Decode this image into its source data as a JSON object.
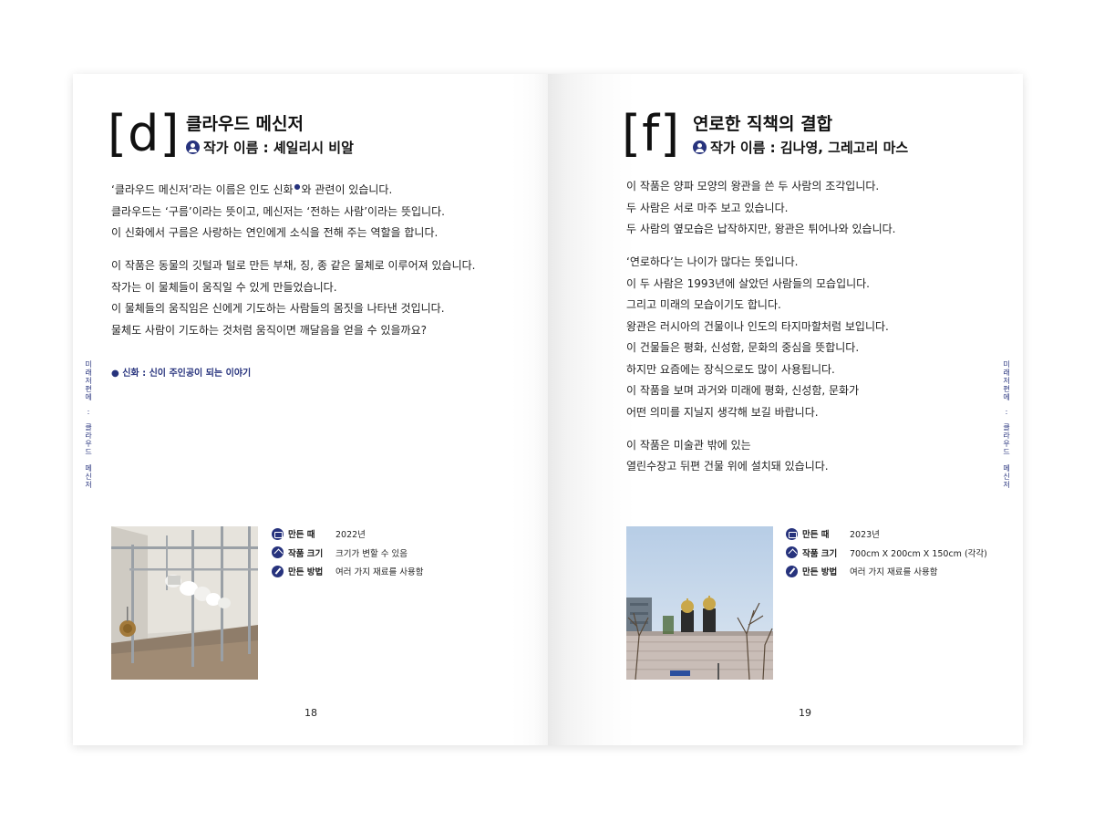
{
  "left_page": {
    "letter": "[d]",
    "title": "클라우드 메신저",
    "artist": "작가 이름 : 셰일리시 비알",
    "paragraphs": [
      {
        "lines": [
          {
            "before": "‘클라우드 메신저’라는 이름은 인도 신화",
            "sup": "●",
            "after": "와 관련이 있습니다."
          },
          {
            "text": "클라우드는 ‘구름’이라는 뜻이고, 메신저는 ‘전하는 사람’이라는 뜻입니다."
          },
          {
            "text": "이 신화에서 구름은 사랑하는 연인에게 소식을 전해 주는 역할을 합니다."
          }
        ]
      },
      {
        "lines": [
          {
            "text": "이 작품은 동물의 깃털과 털로 만든 부채, 징, 종 같은 물체로 이루어져 있습니다."
          },
          {
            "text": "작가는 이 물체들이 움직일 수 있게 만들었습니다."
          },
          {
            "text": "이 물체들의 움직임은 신에게 기도하는 사람들의 몸짓을 나타낸 것입니다."
          },
          {
            "text": "물체도 사람이 기도하는 것처럼 움직이면 깨달음을 얻을 수 있을까요?"
          }
        ]
      }
    ],
    "footnote": "● 신화 : 신이 주인공이 되는 이야기",
    "side_label": "미래저편에 : 클라우드 메신저",
    "meta": [
      {
        "icon": "calendar-icon",
        "label": "만든 때",
        "value": "2022년"
      },
      {
        "icon": "size-icon",
        "label": "작품 크기",
        "value": "크기가 변할 수 있음"
      },
      {
        "icon": "pen-icon",
        "label": "만든 방법",
        "value": "여러 가지 재료를 사용함"
      }
    ],
    "page_number": "18"
  },
  "right_page": {
    "letter": "[f]",
    "title": "연로한 직책의 결합",
    "artist": "작가 이름 : 김나영, 그레고리 마스",
    "paragraphs": [
      {
        "lines": [
          {
            "text": "이 작품은 양파 모양의 왕관을 쓴 두 사람의 조각입니다."
          },
          {
            "text": "두 사람은 서로 마주 보고 있습니다."
          },
          {
            "text": "두 사람의 옆모습은 납작하지만, 왕관은 튀어나와 있습니다."
          }
        ]
      },
      {
        "lines": [
          {
            "text": "‘연로하다’는 나이가 많다는 뜻입니다."
          },
          {
            "text": "이 두 사람은 1993년에 살았던 사람들의 모습입니다."
          },
          {
            "text": "그리고 미래의 모습이기도 합니다."
          },
          {
            "text": "왕관은 러시아의 건물이나 인도의 타지마할처럼 보입니다."
          },
          {
            "text": "이 건물들은 평화, 신성함, 문화의 중심을 뜻합니다."
          },
          {
            "text": "하지만 요즘에는 장식으로도 많이 사용됩니다."
          },
          {
            "text": "이 작품을 보며 과거와 미래에 평화, 신성함, 문화가"
          },
          {
            "text": "어떤 의미를 지닐지 생각해 보길 바랍니다."
          }
        ]
      },
      {
        "lines": [
          {
            "text": "이 작품은 미술관 밖에 있는"
          },
          {
            "text": "열린수장고 뒤편 건물 위에 설치돼 있습니다."
          }
        ]
      }
    ],
    "side_label": "미래저편에 : 클라우드 메신저",
    "meta": [
      {
        "icon": "calendar-icon",
        "label": "만든 때",
        "value": "2023년"
      },
      {
        "icon": "size-icon",
        "label": "작품 크기",
        "value": "700cm X 200cm X 150cm (각각)"
      },
      {
        "icon": "pen-icon",
        "label": "만든 방법",
        "value": "여러 가지 재료를 사용함"
      }
    ],
    "page_number": "19"
  },
  "colors": {
    "accent": "#27337d",
    "text": "#222222"
  }
}
